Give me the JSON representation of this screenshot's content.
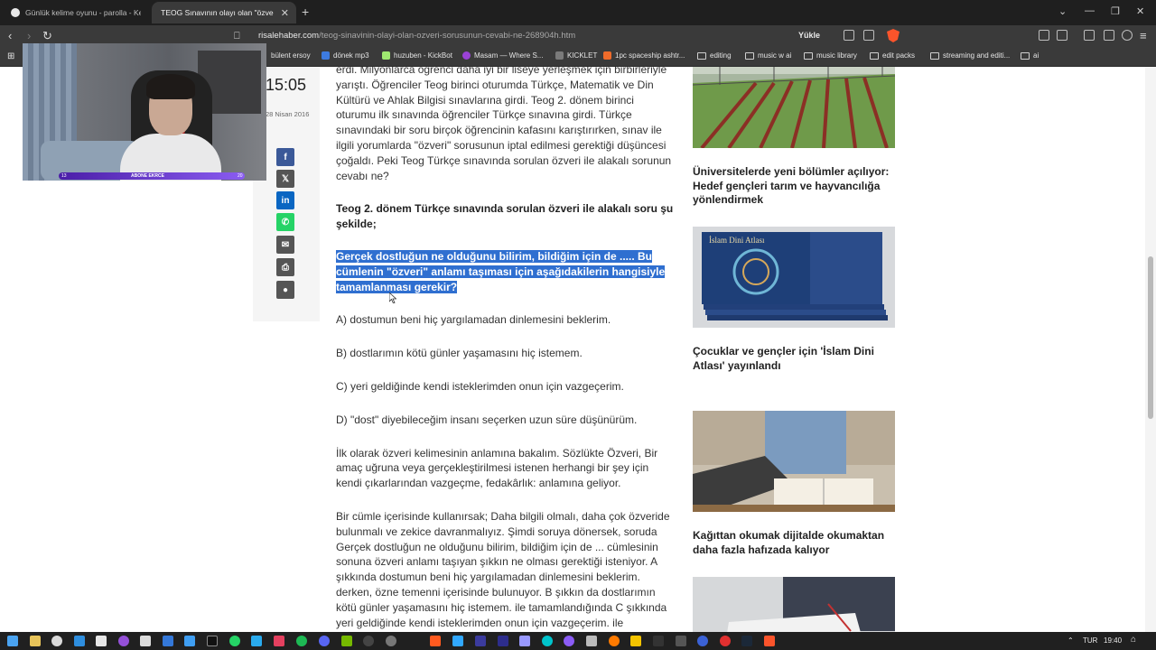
{
  "browser": {
    "tabs": [
      {
        "title": "Günlük kelime oyunu - parolla - Keli"
      },
      {
        "title": "TEOG Sınavının olayı olan \"özve"
      }
    ],
    "url_host": "risalehaber.com",
    "url_path": "/teog-sinavinin-olayi-olan-ozveri-sorusunun-cevabi-ne-268904h.htm",
    "yukle_label": "Yükle",
    "bookmarks": [
      "bülent ersoy",
      "dönek mp3",
      "huzuben - KickBot",
      "Masam — Where S...",
      "KICKLET",
      "1pc spaceship ashtr...",
      "editing",
      "music w ai",
      "music library",
      "edit packs",
      "streaming and editi...",
      "ai"
    ]
  },
  "page": {
    "time": "15:05",
    "date": "28 Nisan 2016",
    "article": {
      "intro": "erdi. Milyonlarca öğrenci daha iyi bir liseye yerleşmek için birbirleriyle yarıştı. Öğrenciler Teog birinci oturumda Türkçe, Matematik ve Din Kültürü ve Ahlak Bilgisi sınavlarına girdi. Teog 2. dönem birinci oturumu ilk sınavında öğrenciler Türkçe sınavına girdi. Türkçe sınavındaki bir soru birçok öğrencinin kafasını karıştırırken, sınav ile ilgili yorumlarda \"özveri\" sorusunun iptal edilmesi gerektiği düşüncesi çoğaldı. Peki Teog Türkçe sınavında sorulan özveri ile alakalı sorunun cevabı ne?",
      "heading": "Teog 2. dönem Türkçe sınavında sorulan özveri ile alakalı soru şu şekilde;",
      "question": "Gerçek dostluğun ne olduğunu bilirim, bildiğim için de ..... Bu cümlenin \"özveri\" anlamı taşıması için aşağıdakilerin hangisiyle tamamlanması gerekir?",
      "options": [
        "A) dostumun beni hiç yargılamadan dinlemesini beklerim.",
        "B) dostlarımın kötü günler yaşamasını hiç istemem.",
        "C) yeri geldiğinde kendi isteklerimden onun için vazgeçerim.",
        "D) \"dost\" diyebileceğim insanı seçerken uzun süre düşünürüm."
      ],
      "para1": "İlk olarak özveri kelimesinin anlamına bakalım. Sözlükte Özveri, Bir amaç uğruna veya gerçekleştirilmesi istenen herhangi bir şey için kendi çıkarlarından vazgeçme, fedakârlık: anlamına geliyor.",
      "para2": "Bir cümle içerisinde kullanırsak; Daha bilgili olmalı, daha çok özveride bulunmalı ve zekice davranmalıyız. Şimdi soruya dönersek, soruda Gerçek dostluğun ne olduğunu bilirim, bildiğim için de ... cümlesinin sonuna özveri anlamı taşıyan şıkkın ne olması gerektiği isteniyor. A şıkkında dostumun beni hiç yargılamadan dinlemesini beklerim. derken, özne temenni içerisinde bulunuyor. B şıkkın da dostlarımın kötü günler yaşamasını hiç istemem. ile tamamlandığında C şıkkında yeri geldiğinde kendi isteklerimden onun için vazgeçerim. ile"
    },
    "sidebar": [
      {
        "title": "Üniversitelerde yeni bölümler açılıyor: Hedef gençleri tarım ve hayvancılığa yönlendirmek"
      },
      {
        "title": "Çocuklar ve gençler için 'İslam Dini Atlası' yayınlandı",
        "book_text": "İslam Dini Atlası"
      },
      {
        "title": "Kağıttan okumak dijitalde okumaktan daha fazla hafızada kalıyor"
      }
    ]
  },
  "webcam": {
    "bar_label": "ABONE EKRCE",
    "left": "13",
    "right": "20"
  },
  "taskbar": {
    "lang": "TUR",
    "clock": "19:40"
  }
}
